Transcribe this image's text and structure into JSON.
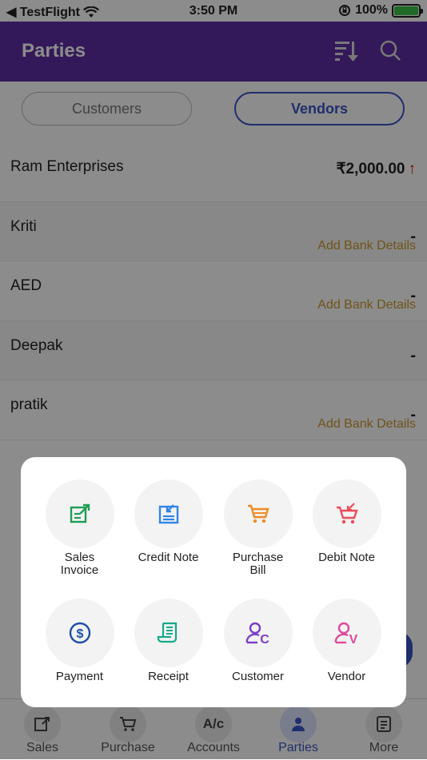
{
  "status_bar": {
    "back_app": "◀ TestFlight",
    "time": "3:50 PM",
    "battery": "100%"
  },
  "header": {
    "title": "Parties",
    "sort_icon": "sort-icon",
    "search_icon": "search-icon"
  },
  "segments": {
    "customers": "Customers",
    "vendors": "Vendors",
    "selected": "vendors"
  },
  "parties": [
    {
      "name": "Ram Enterprises",
      "amount": "₹2,000.00",
      "arrow": "↑"
    },
    {
      "name": "Kriti",
      "amount": "-",
      "bank_link": "Add Bank Details"
    },
    {
      "name": "AED",
      "amount": "-",
      "bank_link": "Add Bank Details"
    },
    {
      "name": "Deepak",
      "amount": "-"
    },
    {
      "name": "pratik",
      "amount": "-",
      "bank_link": "Add Bank Details"
    }
  ],
  "quick_actions": [
    {
      "label": "Sales\nInvoice",
      "icon": "sales-invoice-icon",
      "color": "#1f9d55"
    },
    {
      "label": "Credit Note",
      "icon": "credit-note-icon",
      "color": "#2f86e6"
    },
    {
      "label": "Purchase\nBill",
      "icon": "purchase-bill-icon",
      "color": "#f08a24"
    },
    {
      "label": "Debit Note",
      "icon": "debit-note-icon",
      "color": "#ee4b5b"
    },
    {
      "label": "Payment",
      "icon": "payment-icon",
      "color": "#1e4fa8"
    },
    {
      "label": "Receipt",
      "icon": "receipt-icon",
      "color": "#14a88a"
    },
    {
      "label": "Customer",
      "icon": "customer-icon",
      "color": "#7a3dc8"
    },
    {
      "label": "Vendor",
      "icon": "vendor-icon",
      "color": "#e0489a"
    }
  ],
  "tabs": [
    {
      "label": "Sales",
      "icon": "sales-icon"
    },
    {
      "label": "Purchase",
      "icon": "cart-icon"
    },
    {
      "label": "Accounts",
      "icon_text": "A/c"
    },
    {
      "label": "Parties",
      "icon": "person-icon",
      "active": true
    },
    {
      "label": "More",
      "icon": "more-icon"
    }
  ],
  "colors": {
    "primary": "#5e2ea3",
    "accent": "#3a55c5",
    "bank_link": "#c99a2e",
    "up_arrow": "#dd1111"
  }
}
